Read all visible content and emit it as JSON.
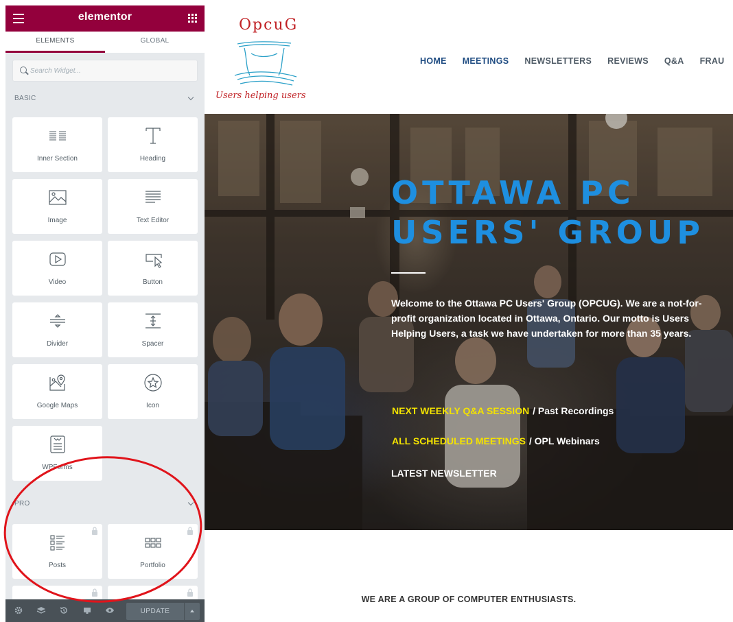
{
  "panel": {
    "brand": "elementor",
    "tabs": [
      "ELEMENTS",
      "GLOBAL"
    ],
    "search": {
      "placeholder": "Search Widget..."
    },
    "basic_category": "BASIC",
    "basic_widgets": [
      "Inner Section",
      "Heading",
      "Image",
      "Text Editor",
      "Video",
      "Button",
      "Divider",
      "Spacer",
      "Google Maps",
      "Icon",
      "WPForms"
    ],
    "pro_category": "PRO",
    "pro_widgets": [
      "Posts",
      "Portfolio"
    ],
    "update_label": "UPDATE",
    "accent_color": "#93003c"
  },
  "site": {
    "logo_wordmark": "OpcuG",
    "logo_tagline": "Users helping users",
    "nav": [
      "HOME",
      "MEETINGS",
      "NEWSLETTERS",
      "REVIEWS",
      "Q&A",
      "FRAU"
    ],
    "hero": {
      "title_line1": "OTTAWA PC",
      "title_line2": "USERS' GROUP",
      "intro": "Welcome to the Ottawa PC Users' Group (OPCUG). We are a not-for-profit organization located in Ottawa, Ontario. Our motto is Users Helping Users, a task we have undertaken for more than 35 years.",
      "link1": "NEXT WEEKLY Q&A SESSION",
      "link1_suffix": " / Past Recordings",
      "link2": "ALL SCHEDULED MEETINGS",
      "link2_suffix": " / OPL Webinars",
      "link3": "LATEST NEWSLETTER",
      "title_color": "#1e8fe0",
      "highlight_color": "#f3e200"
    },
    "tagline": "WE ARE A GROUP OF COMPUTER ENTHUSIASTS."
  }
}
